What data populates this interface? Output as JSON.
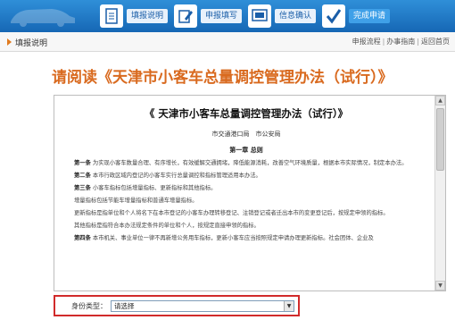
{
  "steps": [
    {
      "label": "填报说明",
      "icon": "document-icon"
    },
    {
      "label": "申报填写",
      "icon": "edit-icon"
    },
    {
      "label": "信息确认",
      "icon": "confirm-icon"
    },
    {
      "label": "完成申请",
      "icon": "checkmark-icon"
    }
  ],
  "sub_header": {
    "title": "填报说明",
    "links": [
      "申报流程",
      "办事指南",
      "返回首页"
    ]
  },
  "page_title": "请阅读《天津市小客车总量调控管理办法（试行）》",
  "document": {
    "title": "《 天津市小客车总量调控管理办法（试行）》",
    "issuer": "市交通港口局　市公安局",
    "chapter": "第一章 总则",
    "paragraphs": [
      {
        "head": "第一条",
        "text": " 为实现小客车数量合理、有序增长，有效缓解交通拥堵，降低能源消耗，改善空气环境质量，根据本市实际情况，制定本办法。"
      },
      {
        "head": "第二条",
        "text": " 本市行政区域内登记的小客车实行总量调控和指标管理适用本办法。"
      },
      {
        "head": "第三条",
        "text": " 小客车指标包括增量指标、更新指标和其他指标。"
      },
      {
        "head": "",
        "text": "增量指标包括节能车增量指标和普通车增量指标。"
      },
      {
        "head": "",
        "text": "更新指标是指单位和个人将名下在本市登记的小客车办理转移登记、注销登记或者迁出本市的变更登记后，按规定申领的指标。"
      },
      {
        "head": "",
        "text": "其他指标是指符合本办法规定条件的单位和个人，按规定直接申领的指标。"
      },
      {
        "head": "第四条",
        "text": " 本市机关、事业单位一律不再新增公务用车指标，更新小客车应当按照规定申请办理更新指标。社会团体、企业及"
      }
    ]
  },
  "id_type": {
    "label": "身份类型：",
    "value": "请选择"
  }
}
